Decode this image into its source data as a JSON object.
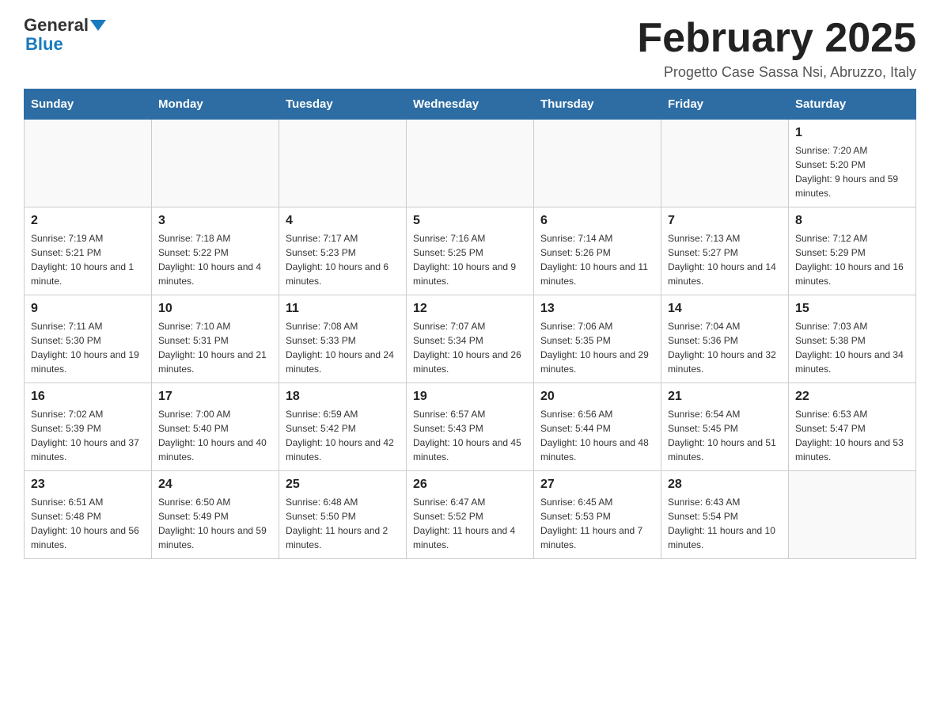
{
  "logo": {
    "text_general": "General",
    "text_blue": "Blue",
    "triangle_alt": "triangle"
  },
  "title": "February 2025",
  "subtitle": "Progetto Case Sassa Nsi, Abruzzo, Italy",
  "days_of_week": [
    "Sunday",
    "Monday",
    "Tuesday",
    "Wednesday",
    "Thursday",
    "Friday",
    "Saturday"
  ],
  "weeks": [
    [
      {
        "day": "",
        "info": ""
      },
      {
        "day": "",
        "info": ""
      },
      {
        "day": "",
        "info": ""
      },
      {
        "day": "",
        "info": ""
      },
      {
        "day": "",
        "info": ""
      },
      {
        "day": "",
        "info": ""
      },
      {
        "day": "1",
        "info": "Sunrise: 7:20 AM\nSunset: 5:20 PM\nDaylight: 9 hours and 59 minutes."
      }
    ],
    [
      {
        "day": "2",
        "info": "Sunrise: 7:19 AM\nSunset: 5:21 PM\nDaylight: 10 hours and 1 minute."
      },
      {
        "day": "3",
        "info": "Sunrise: 7:18 AM\nSunset: 5:22 PM\nDaylight: 10 hours and 4 minutes."
      },
      {
        "day": "4",
        "info": "Sunrise: 7:17 AM\nSunset: 5:23 PM\nDaylight: 10 hours and 6 minutes."
      },
      {
        "day": "5",
        "info": "Sunrise: 7:16 AM\nSunset: 5:25 PM\nDaylight: 10 hours and 9 minutes."
      },
      {
        "day": "6",
        "info": "Sunrise: 7:14 AM\nSunset: 5:26 PM\nDaylight: 10 hours and 11 minutes."
      },
      {
        "day": "7",
        "info": "Sunrise: 7:13 AM\nSunset: 5:27 PM\nDaylight: 10 hours and 14 minutes."
      },
      {
        "day": "8",
        "info": "Sunrise: 7:12 AM\nSunset: 5:29 PM\nDaylight: 10 hours and 16 minutes."
      }
    ],
    [
      {
        "day": "9",
        "info": "Sunrise: 7:11 AM\nSunset: 5:30 PM\nDaylight: 10 hours and 19 minutes."
      },
      {
        "day": "10",
        "info": "Sunrise: 7:10 AM\nSunset: 5:31 PM\nDaylight: 10 hours and 21 minutes."
      },
      {
        "day": "11",
        "info": "Sunrise: 7:08 AM\nSunset: 5:33 PM\nDaylight: 10 hours and 24 minutes."
      },
      {
        "day": "12",
        "info": "Sunrise: 7:07 AM\nSunset: 5:34 PM\nDaylight: 10 hours and 26 minutes."
      },
      {
        "day": "13",
        "info": "Sunrise: 7:06 AM\nSunset: 5:35 PM\nDaylight: 10 hours and 29 minutes."
      },
      {
        "day": "14",
        "info": "Sunrise: 7:04 AM\nSunset: 5:36 PM\nDaylight: 10 hours and 32 minutes."
      },
      {
        "day": "15",
        "info": "Sunrise: 7:03 AM\nSunset: 5:38 PM\nDaylight: 10 hours and 34 minutes."
      }
    ],
    [
      {
        "day": "16",
        "info": "Sunrise: 7:02 AM\nSunset: 5:39 PM\nDaylight: 10 hours and 37 minutes."
      },
      {
        "day": "17",
        "info": "Sunrise: 7:00 AM\nSunset: 5:40 PM\nDaylight: 10 hours and 40 minutes."
      },
      {
        "day": "18",
        "info": "Sunrise: 6:59 AM\nSunset: 5:42 PM\nDaylight: 10 hours and 42 minutes."
      },
      {
        "day": "19",
        "info": "Sunrise: 6:57 AM\nSunset: 5:43 PM\nDaylight: 10 hours and 45 minutes."
      },
      {
        "day": "20",
        "info": "Sunrise: 6:56 AM\nSunset: 5:44 PM\nDaylight: 10 hours and 48 minutes."
      },
      {
        "day": "21",
        "info": "Sunrise: 6:54 AM\nSunset: 5:45 PM\nDaylight: 10 hours and 51 minutes."
      },
      {
        "day": "22",
        "info": "Sunrise: 6:53 AM\nSunset: 5:47 PM\nDaylight: 10 hours and 53 minutes."
      }
    ],
    [
      {
        "day": "23",
        "info": "Sunrise: 6:51 AM\nSunset: 5:48 PM\nDaylight: 10 hours and 56 minutes."
      },
      {
        "day": "24",
        "info": "Sunrise: 6:50 AM\nSunset: 5:49 PM\nDaylight: 10 hours and 59 minutes."
      },
      {
        "day": "25",
        "info": "Sunrise: 6:48 AM\nSunset: 5:50 PM\nDaylight: 11 hours and 2 minutes."
      },
      {
        "day": "26",
        "info": "Sunrise: 6:47 AM\nSunset: 5:52 PM\nDaylight: 11 hours and 4 minutes."
      },
      {
        "day": "27",
        "info": "Sunrise: 6:45 AM\nSunset: 5:53 PM\nDaylight: 11 hours and 7 minutes."
      },
      {
        "day": "28",
        "info": "Sunrise: 6:43 AM\nSunset: 5:54 PM\nDaylight: 11 hours and 10 minutes."
      },
      {
        "day": "",
        "info": ""
      }
    ]
  ]
}
